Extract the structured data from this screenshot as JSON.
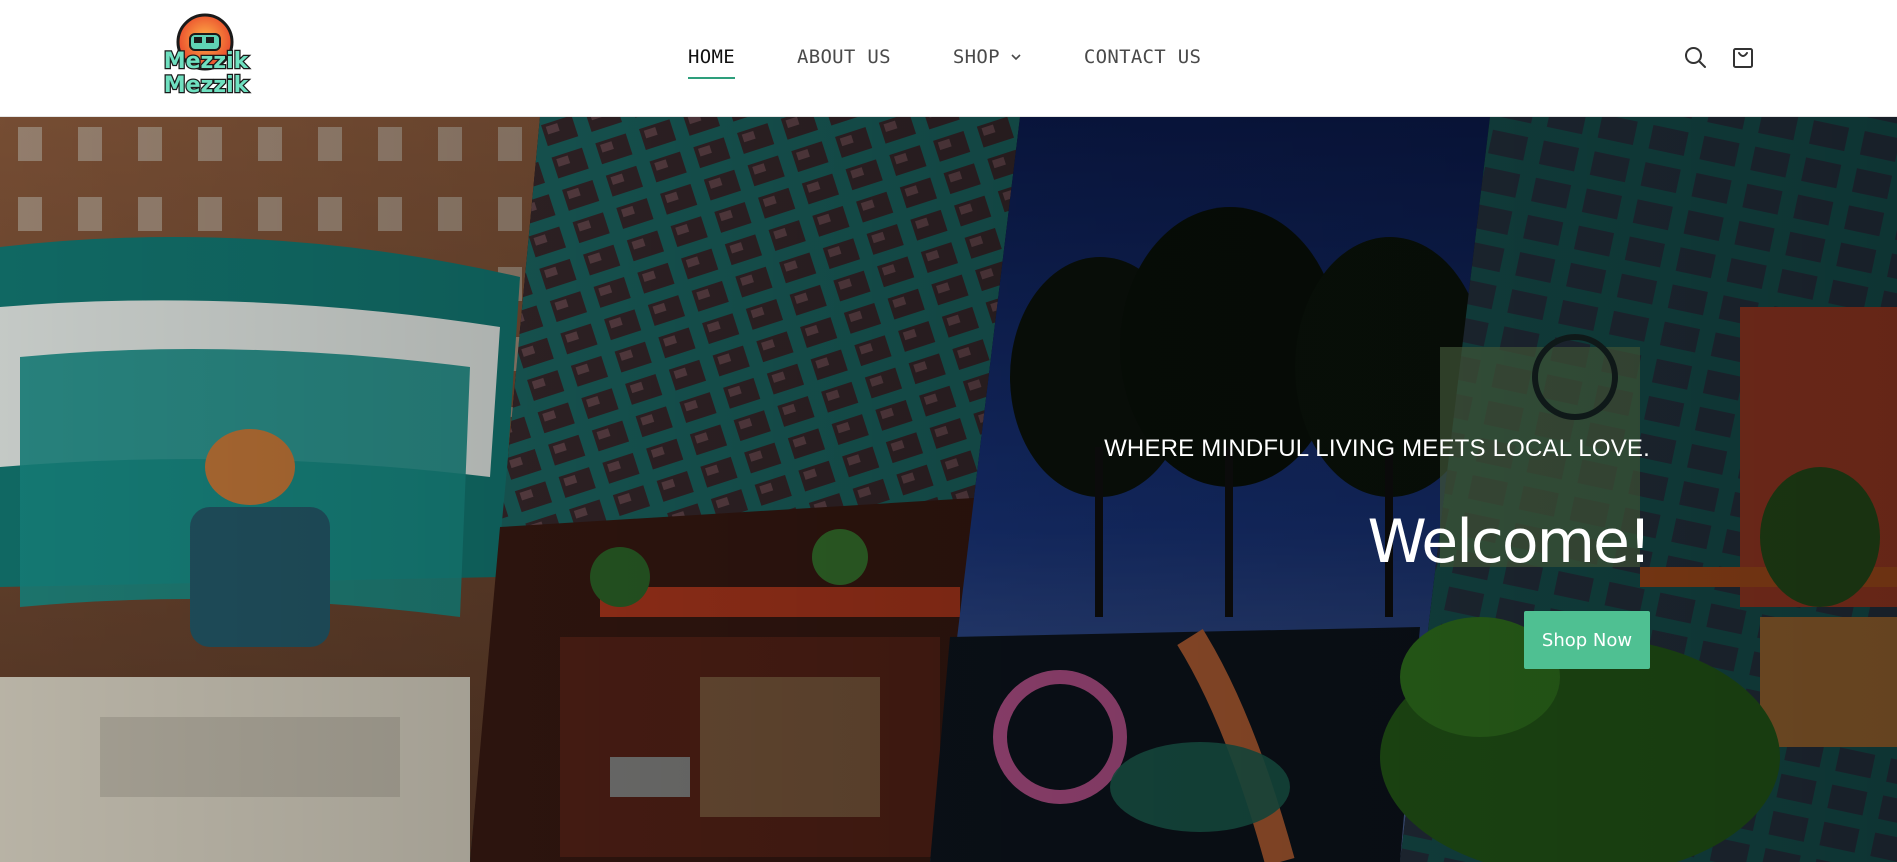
{
  "brand": {
    "logo_text_line1": "Mezzik",
    "logo_text_line2": "Mezzik"
  },
  "nav": {
    "items": [
      {
        "label": "HOME",
        "active": true
      },
      {
        "label": "ABOUT US",
        "active": false
      },
      {
        "label": "SHOP",
        "active": false,
        "has_dropdown": true
      },
      {
        "label": "CONTACT US",
        "active": false
      }
    ]
  },
  "header_icons": [
    "search-icon",
    "shopping-bag-icon"
  ],
  "hero": {
    "tagline": "WHERE MINDFUL LIVING MEETS LOCAL LOVE.",
    "title": "Welcome!",
    "cta_label": "Shop Now"
  },
  "colors": {
    "accent": "#4fc092",
    "active_underline": "#2e9f7c",
    "header_bg": "#ffffff",
    "nav_text": "#4a4a4a"
  }
}
